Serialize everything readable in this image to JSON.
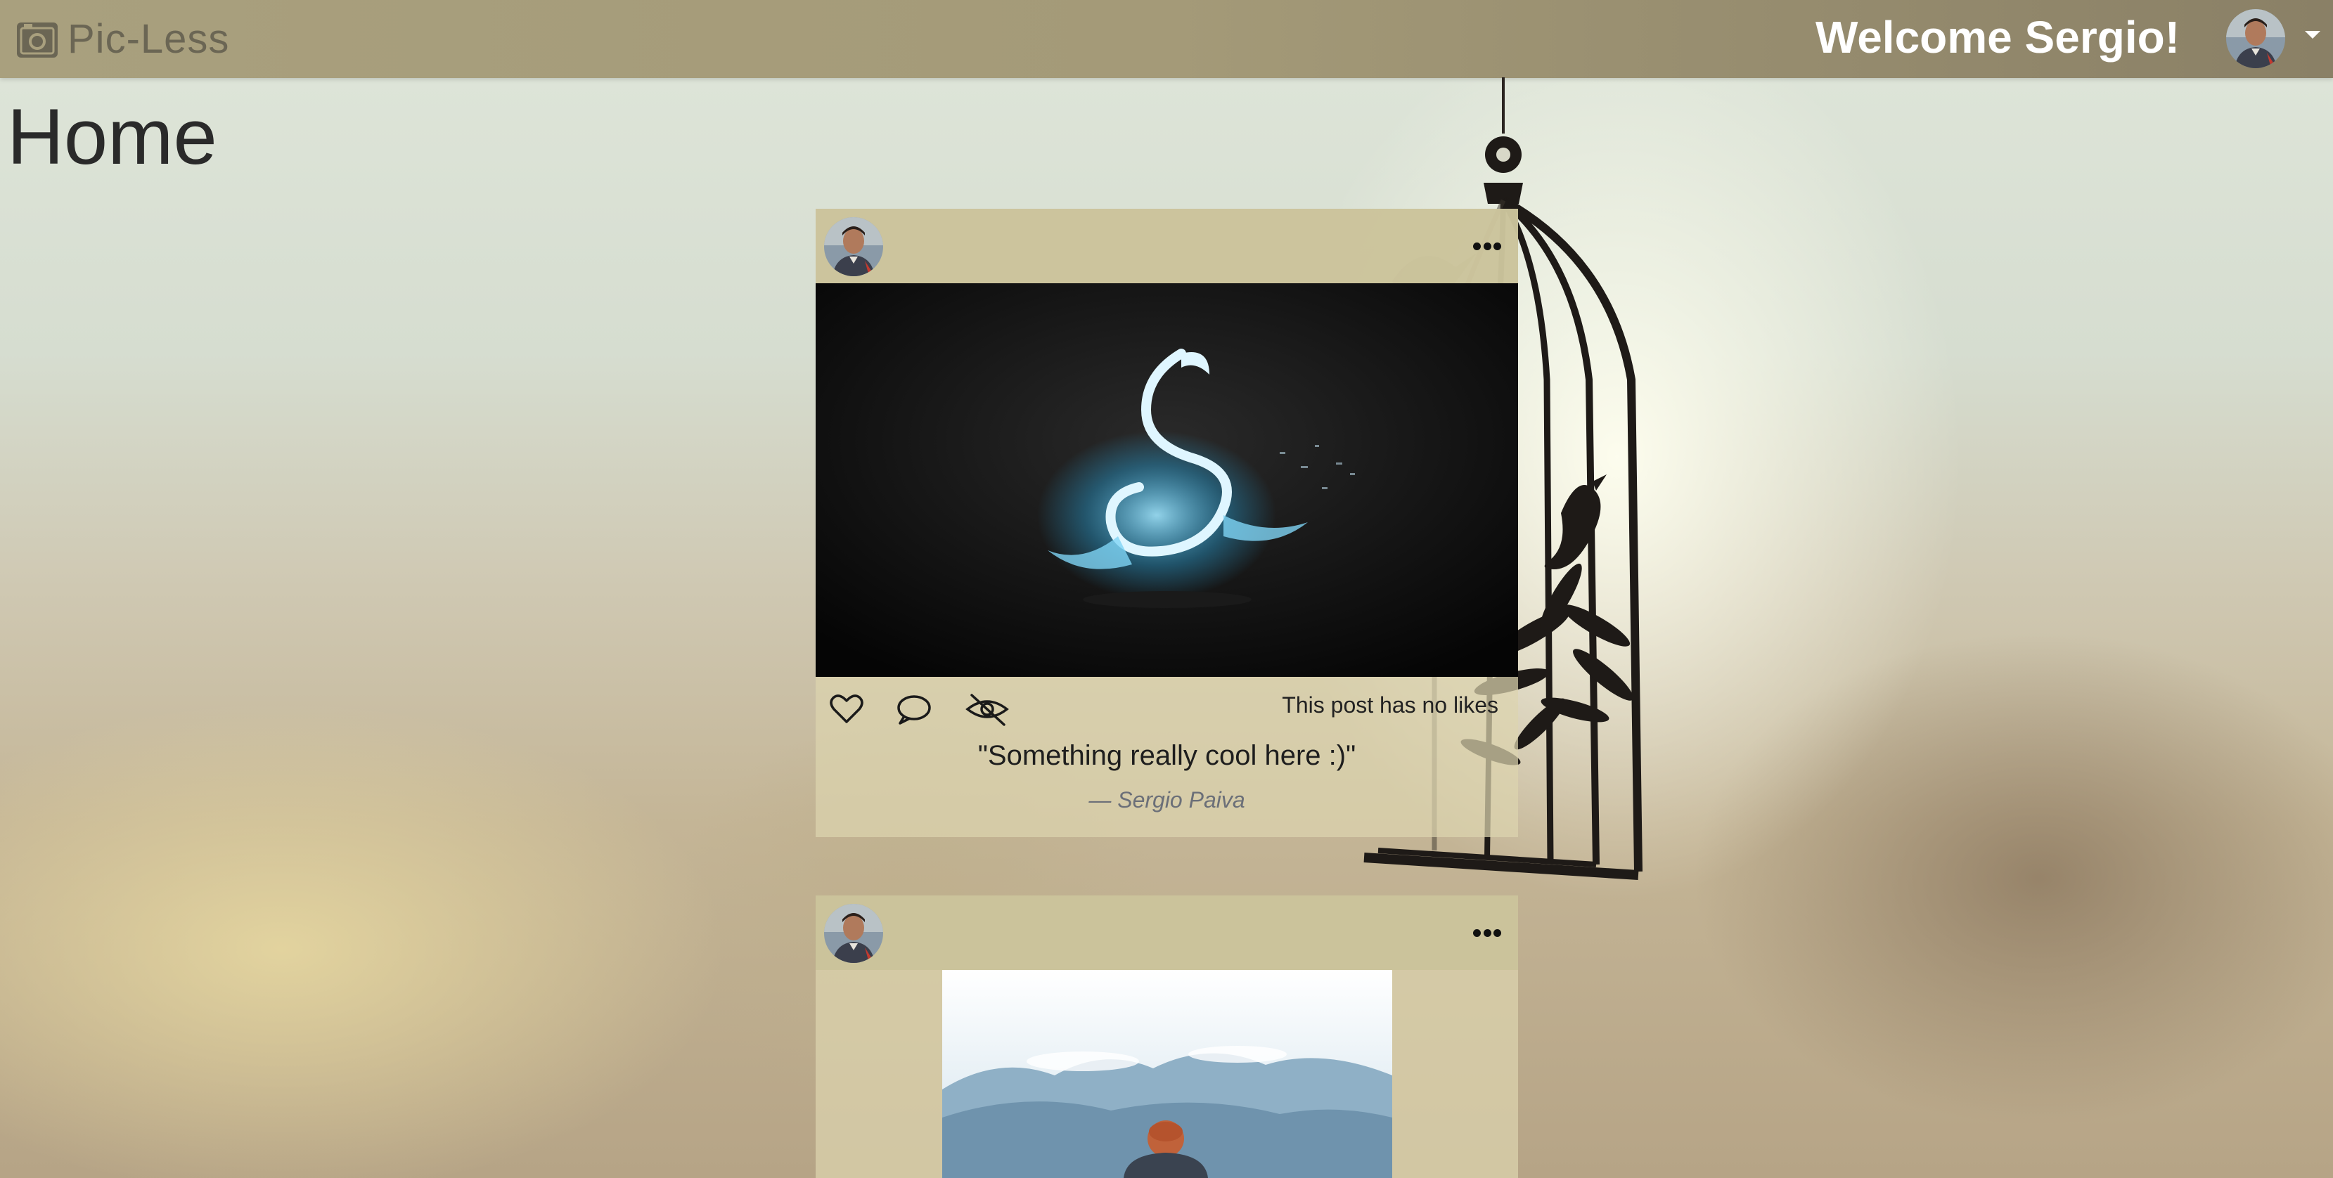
{
  "app": {
    "brand": "Pic-Less"
  },
  "header": {
    "welcome": "Welcome Sergio!"
  },
  "page": {
    "title": "Home"
  },
  "posts": [
    {
      "likes_text": "This post has no likes",
      "caption": "\"Something really cool here :)\"",
      "author": "— Sergio Paiva"
    },
    {
      "likes_text": "",
      "caption": "",
      "author": ""
    }
  ],
  "colors": {
    "navbar": "#a49a78",
    "brand_text": "#6b6654",
    "card": "#dcd4af",
    "card_header": "#cac29a"
  }
}
